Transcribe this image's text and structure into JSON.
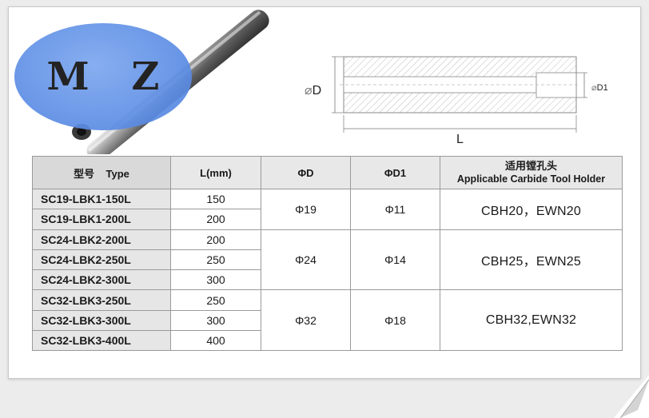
{
  "logo": {
    "text": "M Z"
  },
  "drawing": {
    "outer_diameter_label": "D",
    "inner_diameter_label": "D1",
    "length_label": "L",
    "diameter_symbol": "⌀"
  },
  "table": {
    "headers": {
      "model_cn": "型号",
      "model_en": "Type",
      "length": "L(mm)",
      "d": "ΦD",
      "d1": "ΦD1",
      "holder_cn": "适用镗孔头",
      "holder_en": "Applicable Carbide Tool Holder"
    },
    "groups": [
      {
        "d": "Φ19",
        "d1": "Φ11",
        "holder": "CBH20，EWN20",
        "rows": [
          {
            "model": "SC19-LBK1-150L",
            "length": "150"
          },
          {
            "model": "SC19-LBK1-200L",
            "length": "200"
          }
        ]
      },
      {
        "d": "Φ24",
        "d1": "Φ14",
        "holder": "CBH25，EWN25",
        "rows": [
          {
            "model": "SC24-LBK2-200L",
            "length": "200"
          },
          {
            "model": "SC24-LBK2-250L",
            "length": "250"
          },
          {
            "model": "SC24-LBK2-300L",
            "length": "300"
          }
        ]
      },
      {
        "d": "Φ32",
        "d1": "Φ18",
        "holder": "CBH32,EWN32",
        "rows": [
          {
            "model": "SC32-LBK3-250L",
            "length": "250"
          },
          {
            "model": "SC32-LBK3-300L",
            "length": "300"
          },
          {
            "model": "SC32-LBK3-400L",
            "length": "400"
          }
        ]
      }
    ]
  }
}
